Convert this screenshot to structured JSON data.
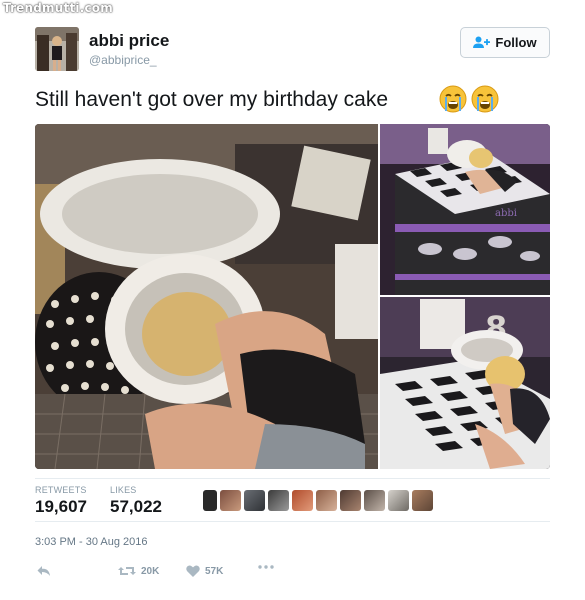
{
  "watermark": "Trendmutti.com",
  "user": {
    "name": "abbi price",
    "handle": "@abbiprice_"
  },
  "follow_button": {
    "label": "Follow",
    "icon": "add-person-icon"
  },
  "tweet": {
    "text": "Still haven't got over my birthday cake",
    "emojis": [
      "loudly-crying-face-icon",
      "loudly-crying-face-icon"
    ]
  },
  "media": {
    "images": [
      "photo-toilet",
      "photo-cake-top",
      "photo-cake-bottom"
    ],
    "cake_text": "abbi",
    "cake_number": "8"
  },
  "stats": {
    "retweets_label": "RETWEETS",
    "retweets_value": "19,607",
    "likes_label": "LIKES",
    "likes_value": "57,022",
    "liker_avatar_count": 10
  },
  "timestamp": "3:03 PM - 30 Aug 2016",
  "actions": {
    "reply_icon": "reply-icon",
    "retweet_icon": "retweet-icon",
    "retweet_count": "20K",
    "like_icon": "heart-icon",
    "like_count": "57K",
    "more_icon": "more-icon"
  },
  "colors": {
    "primary_text": "#14171a",
    "secondary_text": "#8899a6",
    "divider": "#e6ecf0",
    "follow_icon": "#1da1f2",
    "action_icon": "#aab8c2"
  }
}
